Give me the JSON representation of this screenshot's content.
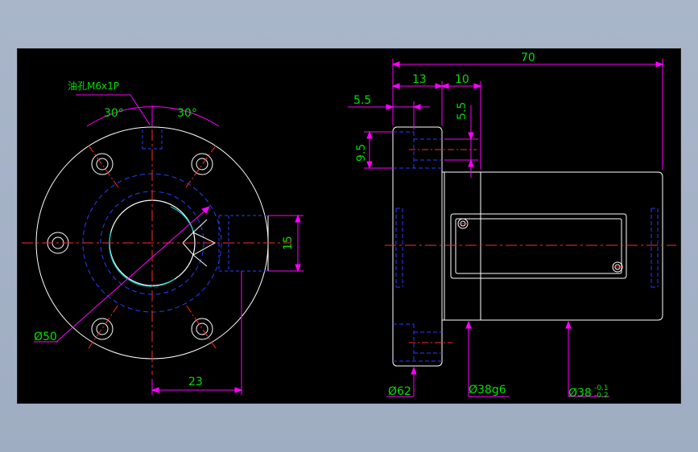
{
  "colors": {
    "background": "#000000",
    "outline": "#ffffff",
    "hidden": "#2a3cff",
    "center": "#ff2a2a",
    "dimension": "#ff00ff",
    "dim_text": "#00e000",
    "seal": "#00c8c8"
  },
  "annotations": {
    "oil_hole": "油孔M6x1P",
    "angle_left": "30°",
    "angle_right": "30°",
    "dia_50": "Ø50",
    "dim_23": "23",
    "dim_15": "15",
    "dim_70": "70",
    "dim_13": "13",
    "dim_10": "10",
    "dim_5_5_h": "5.5",
    "dim_5_5_v": "5.5",
    "dim_9_5": "9.5",
    "dia_62": "Ø62",
    "dia_38g6": "Ø38g6",
    "dia_38": "Ø38",
    "tol_upper": "-0.1",
    "tol_lower": "-0.2"
  }
}
